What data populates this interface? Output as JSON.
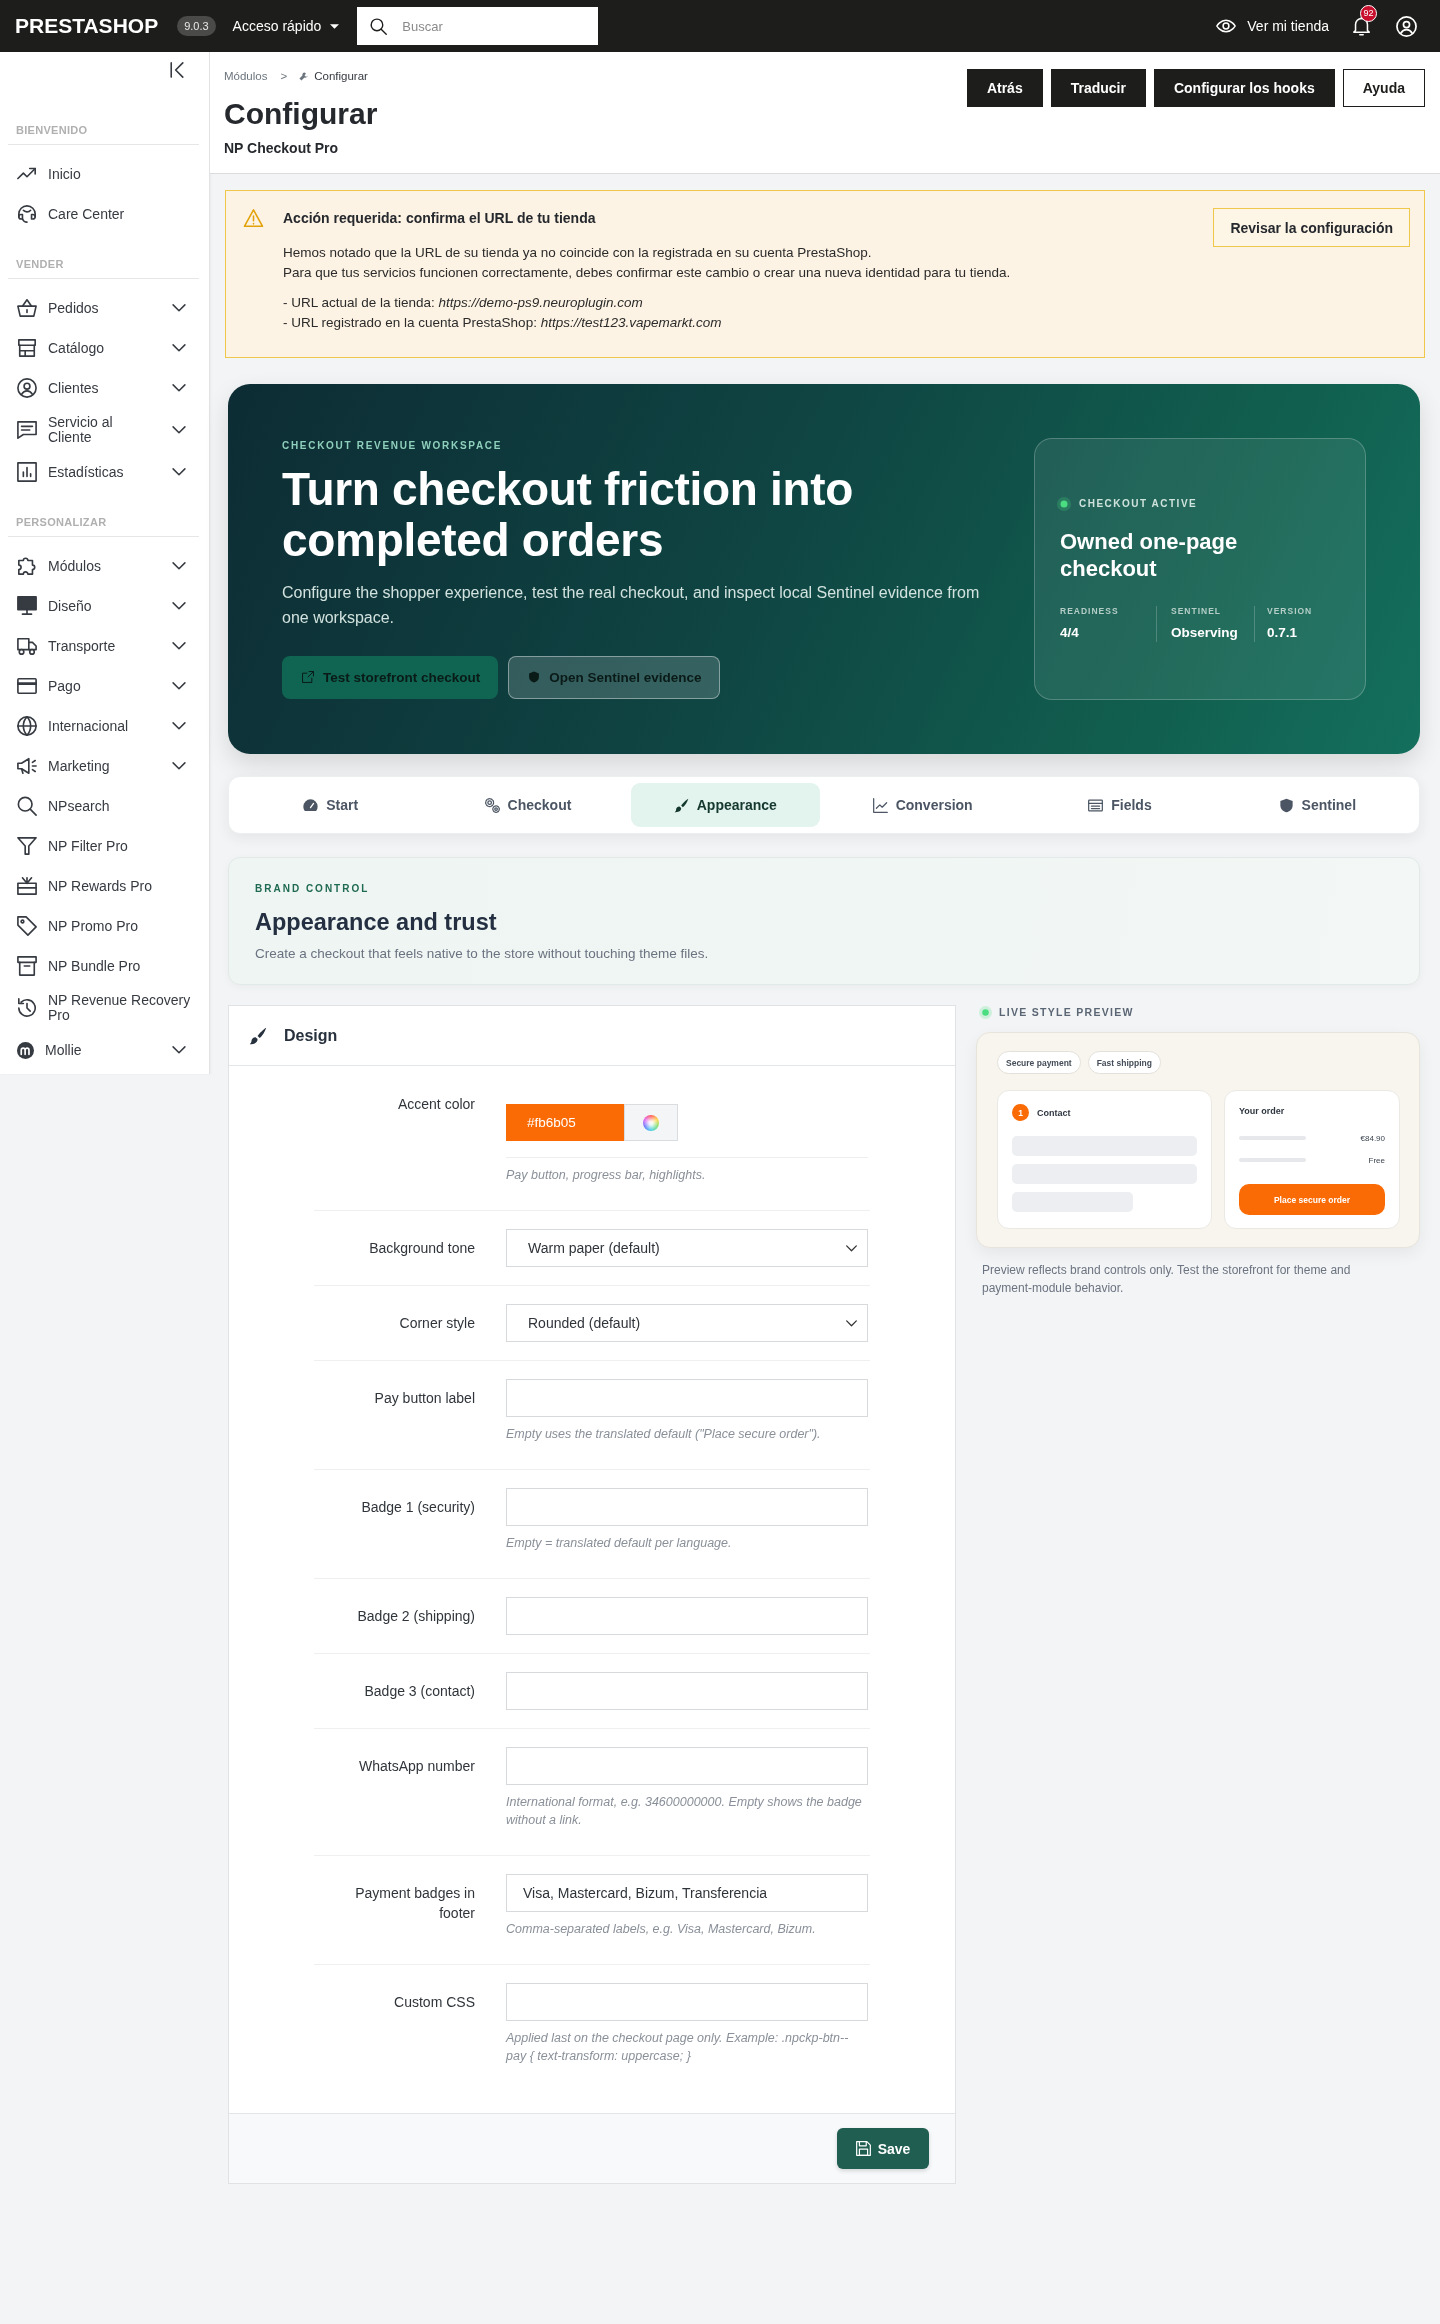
{
  "topbar": {
    "logo": "PRESTASHOP",
    "version": "9.0.3",
    "quick_access": "Acceso rápido",
    "search": {
      "placeholder": "Buscar"
    },
    "view_store": "Ver mi tienda",
    "notifications": "92"
  },
  "sidebar": {
    "sections": [
      {
        "title": "BIENVENIDO",
        "items": [
          {
            "label": "Inicio",
            "has_submenu": false
          },
          {
            "label": "Care Center",
            "has_submenu": false
          }
        ]
      },
      {
        "title": "VENDER",
        "items": [
          {
            "label": "Pedidos",
            "has_submenu": true
          },
          {
            "label": "Catálogo",
            "has_submenu": true
          },
          {
            "label": "Clientes",
            "has_submenu": true
          },
          {
            "label": "Servicio al Cliente",
            "has_submenu": true
          },
          {
            "label": "Estadísticas",
            "has_submenu": true
          }
        ]
      },
      {
        "title": "PERSONALIZAR",
        "items": [
          {
            "label": "Módulos",
            "has_submenu": true
          },
          {
            "label": "Diseño",
            "has_submenu": true
          },
          {
            "label": "Transporte",
            "has_submenu": true
          },
          {
            "label": "Pago",
            "has_submenu": true
          },
          {
            "label": "Internacional",
            "has_submenu": true
          },
          {
            "label": "Marketing",
            "has_submenu": true
          },
          {
            "label": "NPsearch",
            "has_submenu": false
          },
          {
            "label": "NP Filter Pro",
            "has_submenu": false
          },
          {
            "label": "NP Rewards Pro",
            "has_submenu": false
          },
          {
            "label": "NP Promo Pro",
            "has_submenu": false
          },
          {
            "label": "NP Bundle Pro",
            "has_submenu": false
          },
          {
            "label": "NP Revenue Recovery Pro",
            "has_submenu": false
          },
          {
            "label": "Mollie",
            "has_submenu": true
          }
        ]
      }
    ]
  },
  "page_header": {
    "breadcrumb": {
      "items": [
        "Módulos",
        "Configurar"
      ],
      "separator": ">"
    },
    "title": "Configurar",
    "subtitle": "NP Checkout Pro",
    "buttons": [
      {
        "label": "Atrás",
        "kind": "dark"
      },
      {
        "label": "Traducir",
        "kind": "dark"
      },
      {
        "label": "Configurar los hooks",
        "kind": "dark"
      },
      {
        "label": "Ayuda",
        "kind": "outline"
      }
    ]
  },
  "alert": {
    "title": "Acción requerida: confirma el URL de tu tienda",
    "message": [
      "Hemos notado que la URL de su tienda ya no coincide con la registrada en su cuenta PrestaShop.",
      "Para que tus servicios funcionen correctamente, debes confirmar este cambio o crear una nueva identidad para tu tienda."
    ],
    "details": [
      "- URL actual de la tienda: *https://demo-ps9.neuroplugin.com*",
      "- URL registrado en la cuenta PrestaShop: *https://test123.vapemarkt.com*"
    ],
    "button": "Revisar la configuración"
  },
  "hero": {
    "eyebrow": "CHECKOUT REVENUE WORKSPACE",
    "title": "Turn checkout friction into completed orders",
    "description": "Configure the shopper experience, test the real checkout, and inspect local Sentinel evidence from one workspace.",
    "buttons": [
      {
        "label": "Test storefront checkout",
        "kind": "solid"
      },
      {
        "label": "Open Sentinel evidence",
        "kind": "outline"
      }
    ],
    "status": {
      "label": "CHECKOUT ACTIVE",
      "title": "Owned one-page checkout",
      "stats": [
        {
          "label": "READINESS",
          "value": "4/4"
        },
        {
          "label": "SENTINEL",
          "value": "Observing"
        },
        {
          "label": "VERSION",
          "value": "0.7.1"
        }
      ]
    }
  },
  "tabs": [
    {
      "label": "Start",
      "selected": false
    },
    {
      "label": "Checkout",
      "selected": false
    },
    {
      "label": "Appearance",
      "selected": true
    },
    {
      "label": "Conversion",
      "selected": false
    },
    {
      "label": "Fields",
      "selected": false
    },
    {
      "label": "Sentinel",
      "selected": false
    }
  ],
  "brand_control": {
    "eyebrow": "BRAND CONTROL",
    "title": "Appearance and trust",
    "description": "Create a checkout that feels native to the store without touching theme files."
  },
  "design": {
    "title": "Design",
    "fields": [
      {
        "kind": "color",
        "label": "Accent color",
        "value": "#fb6b05",
        "color": "#fb6b05",
        "help": "Pay button, progress bar, highlights."
      },
      {
        "kind": "select",
        "label": "Background tone",
        "value": "Warm paper (default)"
      },
      {
        "kind": "select",
        "label": "Corner style",
        "value": "Rounded (default)"
      },
      {
        "kind": "text",
        "label": "Pay button label",
        "help": "Empty uses the translated default (\"Place secure order\")."
      },
      {
        "kind": "text",
        "label": "Badge 1 (security)",
        "help": "Empty = translated default per language."
      },
      {
        "kind": "text",
        "label": "Badge 2 (shipping)"
      },
      {
        "kind": "text",
        "label": "Badge 3 (contact)"
      },
      {
        "kind": "text",
        "label": "WhatsApp number",
        "help": "International format, e.g. 34600000000. Empty shows the badge without a link."
      },
      {
        "kind": "text",
        "label": "Payment badges in footer",
        "value": "Visa, Mastercard, Bizum, Transferencia",
        "help": "Comma-separated labels, e.g. Visa, Mastercard, Bizum."
      },
      {
        "kind": "text",
        "label": "Custom CSS",
        "help": "Applied last on the checkout page only. Example: .npckp-btn--pay { text-transform: uppercase; }"
      }
    ],
    "save": "Save"
  },
  "preview": {
    "label": "LIVE STYLE PREVIEW",
    "badges": [
      "Secure payment",
      "Fast shipping"
    ],
    "contact": {
      "step": "1",
      "title": "Contact"
    },
    "order": {
      "title": "Your order",
      "lines": [
        "€84.90",
        "Free"
      ],
      "button": "Place secure order"
    },
    "caption": "Preview reflects brand controls only. Test the storefront for theme and payment-module behavior."
  }
}
